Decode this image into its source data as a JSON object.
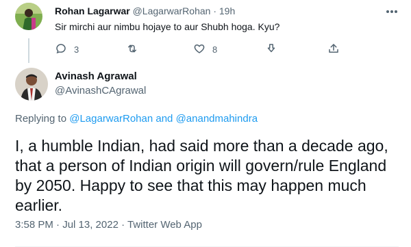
{
  "reply": {
    "author_name": "Rohan Lagarwar",
    "author_handle": "@LagarwarRohan",
    "separator": "·",
    "time": "19h",
    "text": "Sir mirchi aur nimbu hojaye to aur Shubh hoga. Kyu?",
    "actions": {
      "reply_count": "3",
      "retweet_count": "",
      "like_count": "8"
    }
  },
  "tweet": {
    "author_name": "Avinash Agrawal",
    "author_handle": "@AvinashCAgrawal",
    "replying_prefix": "Replying to",
    "replying_user1": "@LagarwarRohan",
    "replying_and": "and",
    "replying_user2": "@anandmahindra",
    "text": "I, a humble Indian, had said more than a decade ago, that a person of Indian origin will govern/rule England by 2050. Happy to see that this may happen much earlier.",
    "timestamp": "3:58 PM · Jul 13, 2022 · Twitter Web App"
  },
  "icons": {
    "more": "more-horizontal-icon",
    "reply": "reply-icon",
    "retweet": "retweet-icon",
    "like": "heart-icon",
    "download": "download-icon",
    "share": "share-icon"
  },
  "colors": {
    "link": "#1d9bf0",
    "secondary_text": "#536471",
    "primary_text": "#0f1419"
  }
}
